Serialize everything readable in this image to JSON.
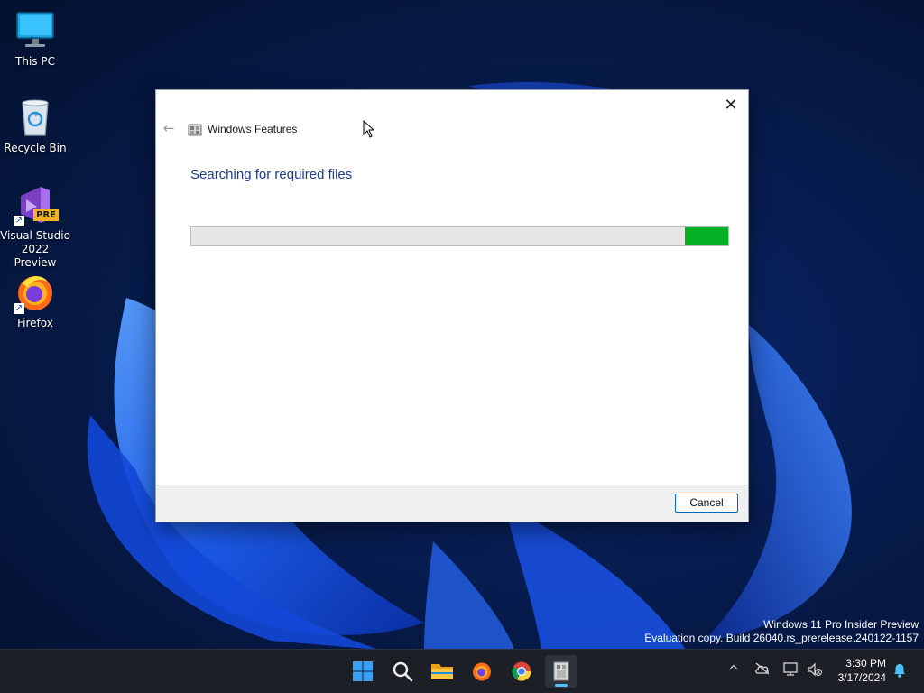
{
  "desktop": {
    "icons": [
      {
        "label": "This PC"
      },
      {
        "label": "Recycle Bin"
      },
      {
        "label": "Visual Studio 2022 Preview",
        "badge": "PRE"
      },
      {
        "label": "Firefox"
      }
    ]
  },
  "dialog": {
    "title": "Windows Features",
    "heading": "Searching for required files",
    "progress_percent": 8,
    "cancel_label": "Cancel",
    "close_glyph": "✕",
    "back_glyph": "←"
  },
  "watermark": {
    "line1": "Windows 11 Pro Insider Preview",
    "line2": "Evaluation copy. Build 26040.rs_prerelease.240122-1157"
  },
  "taskbar": {
    "apps": [
      "windows-start-icon",
      "search-icon",
      "file-explorer-icon",
      "firefox-icon",
      "chrome-icon",
      "windows-features-icon"
    ],
    "tray": {
      "chevron": "^",
      "time": "3:30 PM",
      "date": "3/17/2024"
    }
  },
  "colors": {
    "accent": "#0067c0",
    "progress": "#06b025",
    "heading": "#1f3e8a",
    "taskbar": "#1c1f26"
  }
}
